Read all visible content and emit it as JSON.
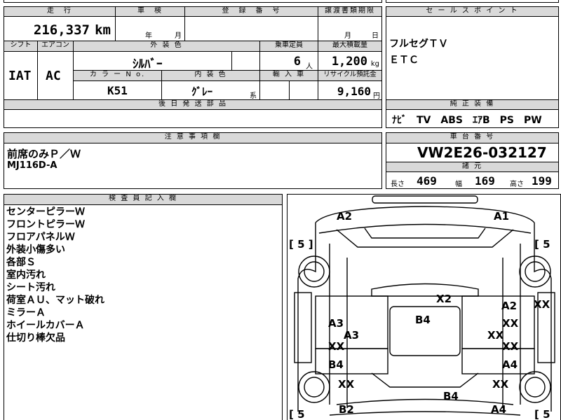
{
  "spec": {
    "mileage_header": "走　行",
    "mileage_value": "216,337",
    "mileage_unit": "km",
    "inspection_header": "車　検",
    "inspection_year": "年",
    "inspection_month": "月",
    "reg_header": "登　録　番　号",
    "transfer_header": "譲渡書類期限",
    "transfer_month": "月",
    "transfer_day": "日",
    "shift_header": "シフト",
    "shift_value": "IAT",
    "ac_header": "エアコン",
    "ac_value": "AC",
    "color_header": "外 装 色",
    "color_value": "ｼﾙﾊﾞｰ",
    "capacity_header": "乗車定員",
    "capacity_value": "6",
    "capacity_unit": "人",
    "maxload_header": "最大積載量",
    "maxload_value": "1,200",
    "maxload_unit": "kg",
    "color_no_header": "カ ラ ー N o.",
    "color_no_value": "K51",
    "interior_header": "内 装 色",
    "interior_value": "ｸﾞﾚｰ",
    "interior_suffix": "系",
    "import_header": "輸 入 車",
    "recycle_header": "リサイクル預託金",
    "recycle_value": "9,160",
    "recycle_unit": "円",
    "later_parts_header": "後 日 発 送 部 品"
  },
  "sales": {
    "header": "セ ー ル ス ポ イ ン ト",
    "lines": [
      "フルセグＴＶ",
      "ＥＴＣ"
    ]
  },
  "equipment": {
    "header": "純 正 装 備",
    "value": "ﾅﾋﾞ　TV　ABS　ｴｱB　PS　PW"
  },
  "caution": {
    "header": "注 意 事 項 欄",
    "lines": [
      "前席のみＰ／Ｗ",
      "MJ116D-A"
    ]
  },
  "chassis": {
    "header": "車 台 番 号",
    "value": "VW2E26-032127"
  },
  "dims": {
    "header": "諸 元",
    "length_label": "長さ",
    "length_value": "469",
    "width_label": "幅",
    "width_value": "169",
    "height_label": "高さ",
    "height_value": "199"
  },
  "inspector": {
    "header": "検 査 員 記 入 欄",
    "lines": [
      "センターピラーＷ",
      "フロントピラーＷ",
      "フロアパネルＷ",
      "外装小傷多い",
      "各部Ｓ",
      "室内汚れ",
      "シート汚れ",
      "荷室ＡＵ、マット破れ",
      "ミラーＡ",
      "ホイールカバーＡ",
      "仕切り棒欠品"
    ]
  },
  "diagram": {
    "marks": [
      {
        "id": "a2-top-left",
        "text": "A2"
      },
      {
        "id": "a1-top-right",
        "text": "A1"
      },
      {
        "id": "tire-fl",
        "text": "[ 5 ]"
      },
      {
        "id": "tire-fr",
        "text": "[ 5"
      },
      {
        "id": "x2-roof",
        "text": "X2"
      },
      {
        "id": "a2-right-front",
        "text": "A2"
      },
      {
        "id": "xx-right-edge",
        "text": "XX"
      },
      {
        "id": "b4-roof",
        "text": "B4"
      },
      {
        "id": "a3-left",
        "text": "A3"
      },
      {
        "id": "xx-right-1",
        "text": "XX"
      },
      {
        "id": "a3-left-2",
        "text": "A3"
      },
      {
        "id": "xx-right-2",
        "text": "XX"
      },
      {
        "id": "xx-left-1",
        "text": "XX"
      },
      {
        "id": "xx-right-3",
        "text": "XX"
      },
      {
        "id": "b4-left",
        "text": "B4"
      },
      {
        "id": "a4-right",
        "text": "A4"
      },
      {
        "id": "xx-left-2",
        "text": "XX"
      },
      {
        "id": "xx-right-4",
        "text": "XX"
      },
      {
        "id": "b4-rear",
        "text": "B4"
      },
      {
        "id": "b2-bottom-left",
        "text": "B2"
      },
      {
        "id": "a4-bottom-right",
        "text": "A4"
      },
      {
        "id": "tire-rl",
        "text": "[ 5"
      },
      {
        "id": "tire-rr",
        "text": "[ 5"
      }
    ]
  }
}
